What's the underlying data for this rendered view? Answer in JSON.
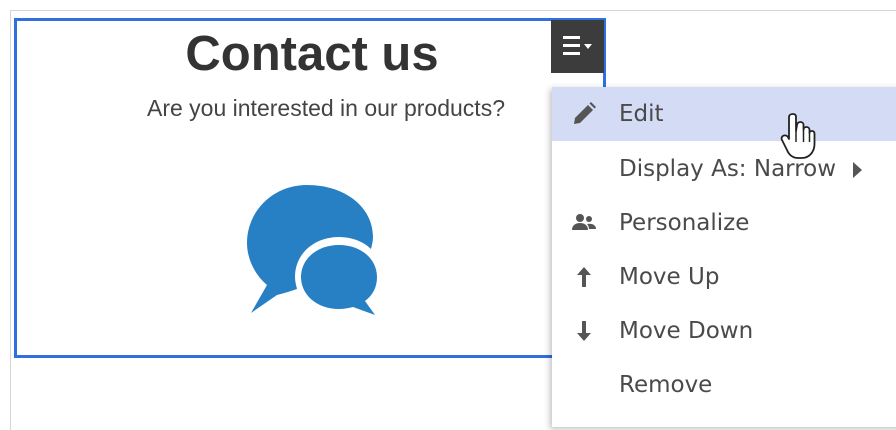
{
  "block": {
    "title": "Contact us",
    "subtitle": "Are you interested in our products?",
    "icon": "chat-bubbles-icon"
  },
  "menu_toggle": {
    "icon": "hamburger-menu-icon"
  },
  "menu": {
    "items": [
      {
        "label": "Edit",
        "icon": "pencil-icon",
        "active": true
      },
      {
        "label": "Display As: Narrow",
        "icon": "",
        "has_submenu": true
      },
      {
        "label": "Personalize",
        "icon": "people-icon"
      },
      {
        "label": "Move Up",
        "icon": "arrow-up-icon"
      },
      {
        "label": "Move Down",
        "icon": "arrow-down-icon"
      },
      {
        "label": "Remove",
        "icon": ""
      }
    ]
  },
  "colors": {
    "block_border": "#2f6fe0",
    "active_item_bg": "#d4dcf5",
    "chat_icon": "#2780c4",
    "toggle_bg": "#3c3c3c"
  }
}
